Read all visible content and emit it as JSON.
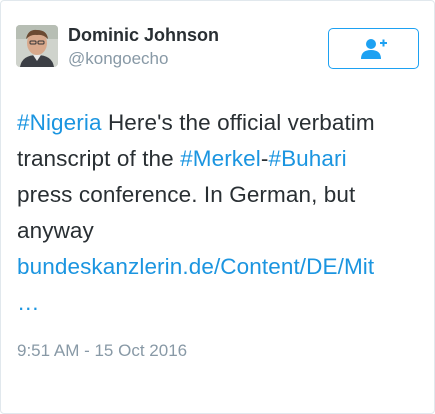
{
  "author": {
    "name": "Dominic Johnson",
    "handle": "@kongoecho"
  },
  "follow_button": {
    "icon": "add-user-icon"
  },
  "tweet": {
    "hashtag_nigeria": "#Nigeria",
    "text_1": " Here's the official verbatim",
    "text_2": "transcript of the ",
    "hashtag_merkel": "#Merkel",
    "dash": "-",
    "hashtag_buhari": "#Buhari",
    "text_3": "press conference. In German, but",
    "text_4": "anyway",
    "link_url": "bundeskanzlerin.de/Content/DE/Mit",
    "link_ellipsis": "…"
  },
  "timestamp": "9:51 AM - 15 Oct 2016",
  "colors": {
    "accent": "#1da1f2",
    "link": "#1b95e0",
    "text": "#292f33",
    "muted": "#8899a6"
  }
}
